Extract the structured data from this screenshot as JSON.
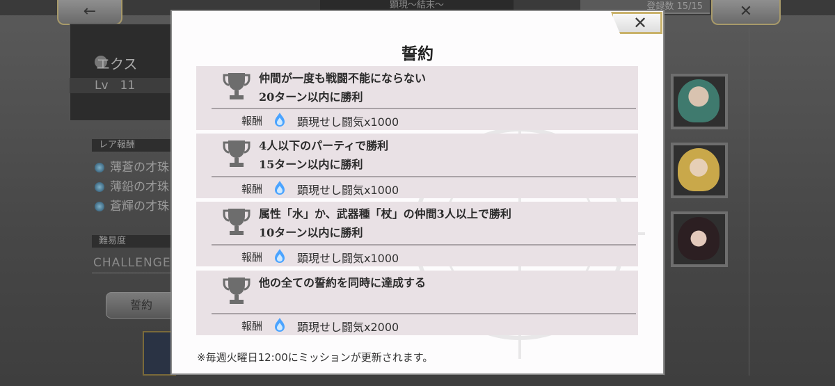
{
  "background": {
    "back_button": "←",
    "stage_title": "顕現～結末～",
    "registered_count": "登録数 15/15",
    "close_button": "✕",
    "character_name": "エクス",
    "level": "Lv　11",
    "rare_reward_header": "レア報酬",
    "rare_rewards": [
      "薄蒼の才珠",
      "薄鉛の才珠",
      "蒼輝の才珠"
    ],
    "difficulty_header": "難易度",
    "difficulty_value": "CHALLENGE",
    "vow_button": "誓約"
  },
  "modal": {
    "title": "誓約",
    "close_label": "✕",
    "reward_label": "報酬",
    "missions": [
      {
        "line1": "仲間が一度も戦闘不能にならない",
        "line2": "20ターン以内に勝利",
        "reward": "顕現せし闘気x1000"
      },
      {
        "line1": "4人以下のパーティで勝利",
        "line2": "15ターン以内に勝利",
        "reward": "顕現せし闘気x1000"
      },
      {
        "line1": "属性「水」か、武器種「杖」の仲間3人以上で勝利",
        "line2": "10ターン以内に勝利",
        "reward": "顕現せし闘気x1000"
      },
      {
        "line1": "他の全ての誓約を同時に達成する",
        "line2": "",
        "reward": "顕現せし闘気x2000"
      }
    ],
    "footnote": "※毎週火曜日12:00にミッションが更新されます。"
  },
  "icons": {
    "trophy": "trophy-icon",
    "reward": "blue-flame-icon"
  },
  "colors": {
    "mission_bg": "#e9e1e5",
    "close_border": "#c9b26b",
    "flame": "#4aa3ff"
  }
}
